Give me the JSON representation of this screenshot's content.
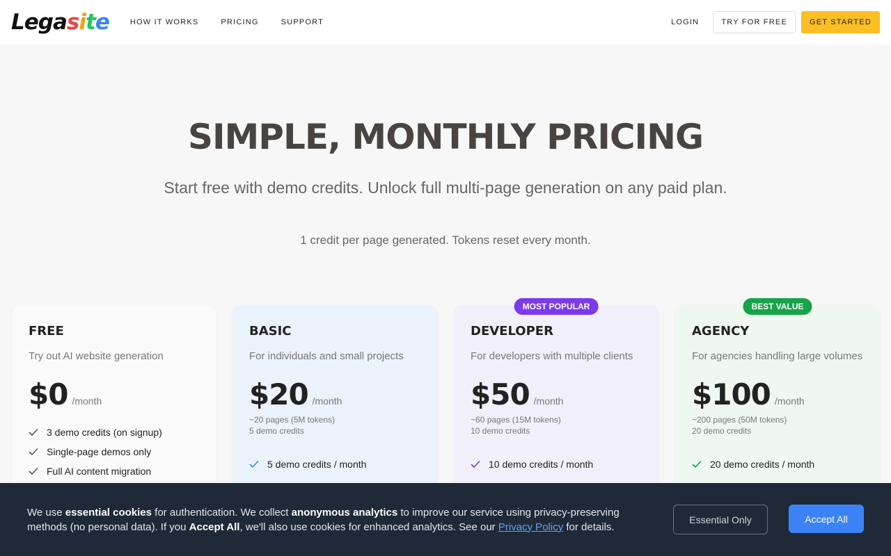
{
  "nav": {
    "logo": [
      "L",
      "e",
      "g",
      "a",
      "s",
      "i",
      "t",
      "e"
    ],
    "logo_colors": [
      "#111111",
      "#111111",
      "#111111",
      "#111111",
      "#ef4444",
      "#f59e0b",
      "#22c55e",
      "#3b82f6"
    ],
    "links": [
      "HOW IT WORKS",
      "PRICING",
      "SUPPORT"
    ],
    "login": "LOGIN",
    "try_free": "TRY FOR FREE",
    "get_started": "GET STARTED"
  },
  "hero": {
    "title": "SIMPLE, MONTHLY PRICING",
    "subtitle": "Start free with demo credits. Unlock full multi-page generation on any paid plan.",
    "note": "1 credit per page generated. Tokens reset every month."
  },
  "plans": [
    {
      "name": "FREE",
      "description": "Try out AI website generation",
      "price": "$0",
      "per": "/month",
      "meta1": "",
      "meta2": "",
      "badge": "",
      "features": [
        "3 demo credits (on signup)",
        "Single-page demos only",
        "Full AI content migration"
      ],
      "check_color": "#555555"
    },
    {
      "name": "BASIC",
      "description": "For individuals and small projects",
      "price": "$20",
      "per": "/month",
      "meta1": "~20 pages (5M tokens)",
      "meta2": "5 demo credits",
      "badge": "",
      "features": [
        "5 demo credits / month"
      ],
      "check_color": "#3b82f6"
    },
    {
      "name": "DEVELOPER",
      "description": "For developers with multiple clients",
      "price": "$50",
      "per": "/month",
      "meta1": "~60 pages (15M tokens)",
      "meta2": "10 demo credits",
      "badge": "MOST POPULAR",
      "features": [
        "10 demo credits / month"
      ],
      "check_color": "#7c3aed"
    },
    {
      "name": "AGENCY",
      "description": "For agencies handling large volumes",
      "price": "$100",
      "per": "/month",
      "meta1": "~200 pages (50M tokens)",
      "meta2": "20 demo credits",
      "badge": "BEST VALUE",
      "features": [
        "20 demo credits / month"
      ],
      "check_color": "#16a34a"
    }
  ],
  "cookie": {
    "t1": "We use ",
    "b1": "essential cookies",
    "t2": " for authentication. We collect ",
    "b2": "anonymous analytics",
    "t3": " to improve our service using privacy-preserving methods (no personal data). If you ",
    "b3": "Accept All",
    "t4": ", we'll also use cookies for enhanced analytics. See our ",
    "link": "Privacy Policy",
    "t5": " for details.",
    "essential_only": "Essential Only",
    "accept_all": "Accept All"
  }
}
